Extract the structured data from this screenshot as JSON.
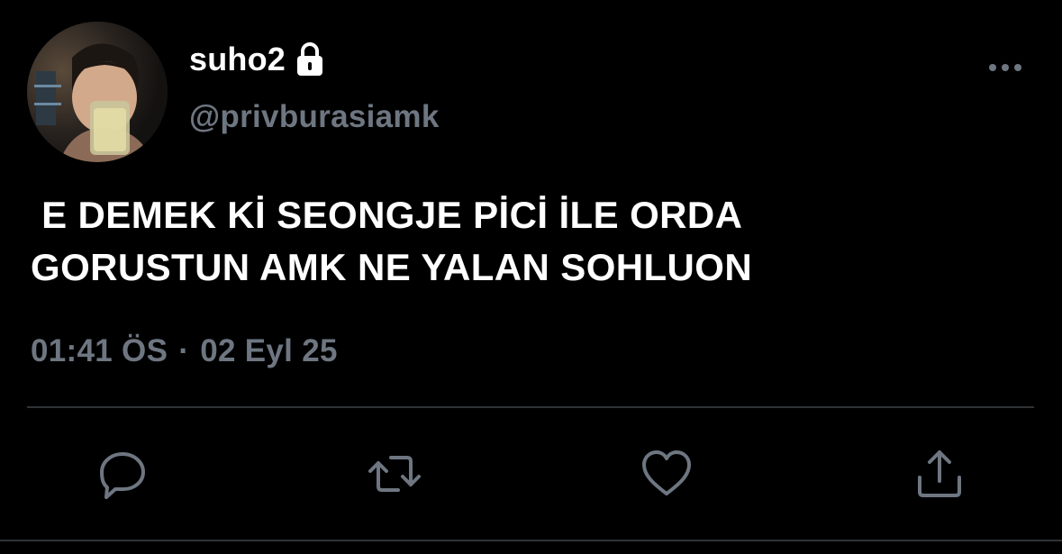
{
  "author": {
    "display_name": "suho2",
    "handle": "@privburasiamk",
    "avatar_icon": "avatar-photo",
    "protected_icon": "lock-icon"
  },
  "tweet": {
    "text": " E DEMEK Kİ SEONGJE PİCİ İLE ORDA\nGORUSTUN AMK NE YALAN SOHLUON",
    "time": "01:41 ÖS",
    "separator": "·",
    "date": "02 Eyl 25"
  },
  "actions": [
    {
      "name": "reply",
      "icon": "comment-icon"
    },
    {
      "name": "retweet",
      "icon": "retweet-icon"
    },
    {
      "name": "like",
      "icon": "heart-icon"
    },
    {
      "name": "share",
      "icon": "share-icon"
    }
  ],
  "colors": {
    "background": "#000000",
    "primary_text": "#ffffff",
    "secondary_text": "#6e7681",
    "divider": "#2f3336"
  }
}
